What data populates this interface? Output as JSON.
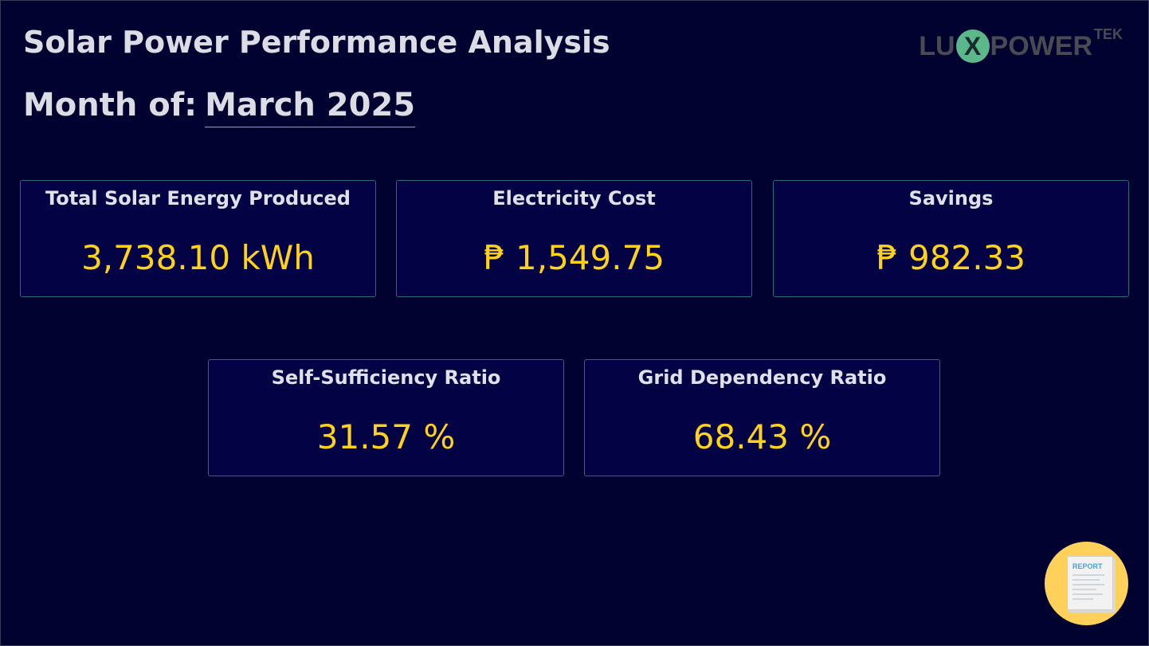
{
  "header": {
    "title": "Solar Power Performance Analysis",
    "month_label": "Month of:",
    "month_value": "March 2025"
  },
  "logo": {
    "part1": "LU",
    "part_x": "X",
    "part2": "POWER",
    "sup": "TEK"
  },
  "cards": {
    "energy": {
      "label": "Total Solar Energy Produced",
      "value": "3,738.10 kWh"
    },
    "cost": {
      "label": "Electricity Cost",
      "value": "₱ 1,549.75"
    },
    "savings": {
      "label": "Savings",
      "value": "₱ 982.33"
    },
    "self": {
      "label": "Self-Sufficiency Ratio",
      "value": "31.57 %"
    },
    "grid": {
      "label": "Grid Dependency Ratio",
      "value": "68.43 %"
    }
  },
  "report_button": {
    "doc_label": "REPORT",
    "icon": "report-document-icon"
  },
  "colors": {
    "background": "#020230",
    "card_background": "#020244",
    "card_border": "#2a6a78",
    "value_yellow": "#ffd21a",
    "text_light": "#dcdce4",
    "report_button": "#ffd05a",
    "logo_accent": "#5bb88a"
  }
}
